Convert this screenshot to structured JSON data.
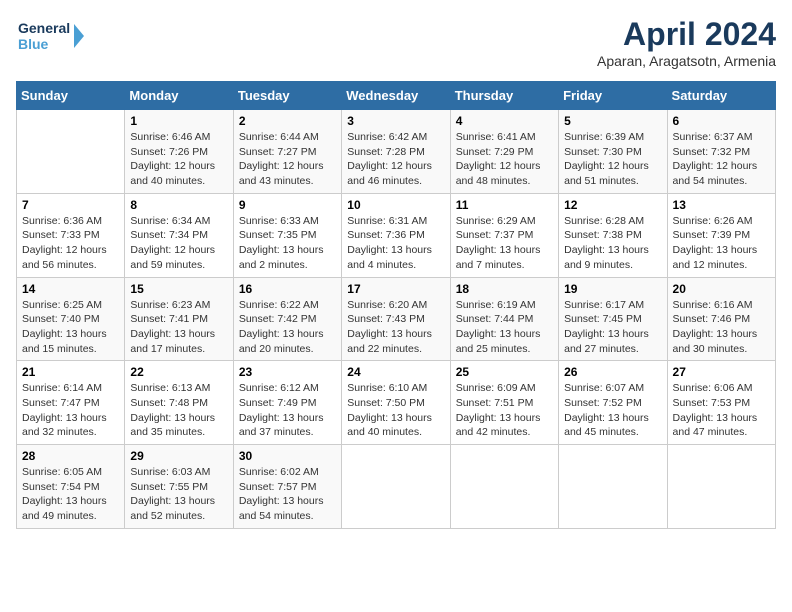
{
  "logo": {
    "line1": "General",
    "line2": "Blue"
  },
  "title": "April 2024",
  "location": "Aparan, Aragatsotn, Armenia",
  "days_header": [
    "Sunday",
    "Monday",
    "Tuesday",
    "Wednesday",
    "Thursday",
    "Friday",
    "Saturday"
  ],
  "weeks": [
    [
      {
        "num": "",
        "text": ""
      },
      {
        "num": "1",
        "text": "Sunrise: 6:46 AM\nSunset: 7:26 PM\nDaylight: 12 hours\nand 40 minutes."
      },
      {
        "num": "2",
        "text": "Sunrise: 6:44 AM\nSunset: 7:27 PM\nDaylight: 12 hours\nand 43 minutes."
      },
      {
        "num": "3",
        "text": "Sunrise: 6:42 AM\nSunset: 7:28 PM\nDaylight: 12 hours\nand 46 minutes."
      },
      {
        "num": "4",
        "text": "Sunrise: 6:41 AM\nSunset: 7:29 PM\nDaylight: 12 hours\nand 48 minutes."
      },
      {
        "num": "5",
        "text": "Sunrise: 6:39 AM\nSunset: 7:30 PM\nDaylight: 12 hours\nand 51 minutes."
      },
      {
        "num": "6",
        "text": "Sunrise: 6:37 AM\nSunset: 7:32 PM\nDaylight: 12 hours\nand 54 minutes."
      }
    ],
    [
      {
        "num": "7",
        "text": "Sunrise: 6:36 AM\nSunset: 7:33 PM\nDaylight: 12 hours\nand 56 minutes."
      },
      {
        "num": "8",
        "text": "Sunrise: 6:34 AM\nSunset: 7:34 PM\nDaylight: 12 hours\nand 59 minutes."
      },
      {
        "num": "9",
        "text": "Sunrise: 6:33 AM\nSunset: 7:35 PM\nDaylight: 13 hours\nand 2 minutes."
      },
      {
        "num": "10",
        "text": "Sunrise: 6:31 AM\nSunset: 7:36 PM\nDaylight: 13 hours\nand 4 minutes."
      },
      {
        "num": "11",
        "text": "Sunrise: 6:29 AM\nSunset: 7:37 PM\nDaylight: 13 hours\nand 7 minutes."
      },
      {
        "num": "12",
        "text": "Sunrise: 6:28 AM\nSunset: 7:38 PM\nDaylight: 13 hours\nand 9 minutes."
      },
      {
        "num": "13",
        "text": "Sunrise: 6:26 AM\nSunset: 7:39 PM\nDaylight: 13 hours\nand 12 minutes."
      }
    ],
    [
      {
        "num": "14",
        "text": "Sunrise: 6:25 AM\nSunset: 7:40 PM\nDaylight: 13 hours\nand 15 minutes."
      },
      {
        "num": "15",
        "text": "Sunrise: 6:23 AM\nSunset: 7:41 PM\nDaylight: 13 hours\nand 17 minutes."
      },
      {
        "num": "16",
        "text": "Sunrise: 6:22 AM\nSunset: 7:42 PM\nDaylight: 13 hours\nand 20 minutes."
      },
      {
        "num": "17",
        "text": "Sunrise: 6:20 AM\nSunset: 7:43 PM\nDaylight: 13 hours\nand 22 minutes."
      },
      {
        "num": "18",
        "text": "Sunrise: 6:19 AM\nSunset: 7:44 PM\nDaylight: 13 hours\nand 25 minutes."
      },
      {
        "num": "19",
        "text": "Sunrise: 6:17 AM\nSunset: 7:45 PM\nDaylight: 13 hours\nand 27 minutes."
      },
      {
        "num": "20",
        "text": "Sunrise: 6:16 AM\nSunset: 7:46 PM\nDaylight: 13 hours\nand 30 minutes."
      }
    ],
    [
      {
        "num": "21",
        "text": "Sunrise: 6:14 AM\nSunset: 7:47 PM\nDaylight: 13 hours\nand 32 minutes."
      },
      {
        "num": "22",
        "text": "Sunrise: 6:13 AM\nSunset: 7:48 PM\nDaylight: 13 hours\nand 35 minutes."
      },
      {
        "num": "23",
        "text": "Sunrise: 6:12 AM\nSunset: 7:49 PM\nDaylight: 13 hours\nand 37 minutes."
      },
      {
        "num": "24",
        "text": "Sunrise: 6:10 AM\nSunset: 7:50 PM\nDaylight: 13 hours\nand 40 minutes."
      },
      {
        "num": "25",
        "text": "Sunrise: 6:09 AM\nSunset: 7:51 PM\nDaylight: 13 hours\nand 42 minutes."
      },
      {
        "num": "26",
        "text": "Sunrise: 6:07 AM\nSunset: 7:52 PM\nDaylight: 13 hours\nand 45 minutes."
      },
      {
        "num": "27",
        "text": "Sunrise: 6:06 AM\nSunset: 7:53 PM\nDaylight: 13 hours\nand 47 minutes."
      }
    ],
    [
      {
        "num": "28",
        "text": "Sunrise: 6:05 AM\nSunset: 7:54 PM\nDaylight: 13 hours\nand 49 minutes."
      },
      {
        "num": "29",
        "text": "Sunrise: 6:03 AM\nSunset: 7:55 PM\nDaylight: 13 hours\nand 52 minutes."
      },
      {
        "num": "30",
        "text": "Sunrise: 6:02 AM\nSunset: 7:57 PM\nDaylight: 13 hours\nand 54 minutes."
      },
      {
        "num": "",
        "text": ""
      },
      {
        "num": "",
        "text": ""
      },
      {
        "num": "",
        "text": ""
      },
      {
        "num": "",
        "text": ""
      }
    ]
  ]
}
